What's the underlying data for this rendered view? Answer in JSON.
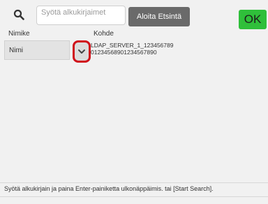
{
  "search": {
    "placeholder": "Syötä alkukirjaimet",
    "icon": "search-icon"
  },
  "toolbar": {
    "start_label": "Aloita Etsintä",
    "ok_label": "OK"
  },
  "columns": {
    "name_header": "Nimike",
    "target_header": "Kohde"
  },
  "row": {
    "name_value": "Nimi",
    "target_line1": "LDAP_SERVER_1_123456789",
    "target_line2": "01234568901234567890"
  },
  "status": {
    "message": "Syötä alkukirjain ja paina Enter-painiketta ulkonäppäimis. tai [Start Search]."
  },
  "colors": {
    "ok_bg": "#2fbf3a",
    "start_bg": "#6a6a6a",
    "highlight": "#d0101a"
  }
}
